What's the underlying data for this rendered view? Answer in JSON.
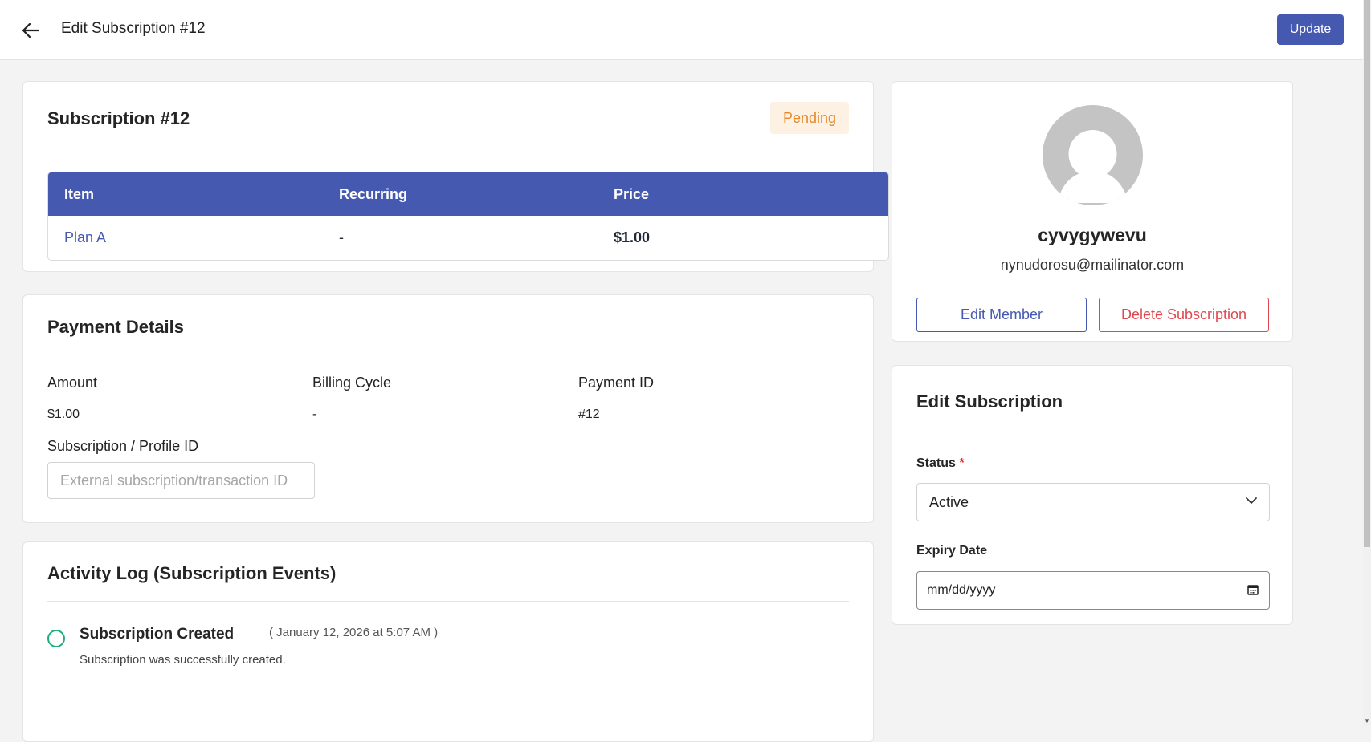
{
  "header": {
    "back_label": "Back",
    "title": "Edit Subscription #12",
    "update_label": "Update"
  },
  "subscription": {
    "title": "Subscription #12",
    "status_badge": "Pending",
    "table": {
      "columns": [
        "Item",
        "Recurring",
        "Price"
      ],
      "rows": [
        {
          "item": "Plan A",
          "recurring": "-",
          "price": "$1.00"
        }
      ]
    }
  },
  "payment": {
    "title": "Payment Details",
    "amount_label": "Amount",
    "amount_value": "$1.00",
    "billing_cycle_label": "Billing Cycle",
    "billing_cycle_value": "-",
    "payment_id_label": "Payment ID",
    "payment_id_value": "#12",
    "profile_id_label": "Subscription / Profile ID",
    "profile_id_placeholder": "External subscription/transaction ID",
    "profile_id_value": ""
  },
  "activity": {
    "title": "Activity Log (Subscription Events)",
    "events": [
      {
        "title": "Subscription Created",
        "time": "( January 12, 2026 at 5:07 AM )",
        "description": "Subscription was successfully created."
      }
    ]
  },
  "member": {
    "name": "cyvygywevu",
    "email": "nynudorosu@mailinator.com",
    "edit_label": "Edit Member",
    "delete_label": "Delete Subscription"
  },
  "edit_form": {
    "title": "Edit Subscription",
    "status_label": "Status",
    "status_required_mark": "*",
    "status_value": "Active",
    "expiry_label": "Expiry Date",
    "expiry_placeholder": "mm/dd/yyyy"
  },
  "colors": {
    "primary": "#4659b1",
    "pending_text": "#e38a2c",
    "pending_bg": "#fdf1e4",
    "danger": "#e0484f",
    "success": "#1fae7a"
  }
}
